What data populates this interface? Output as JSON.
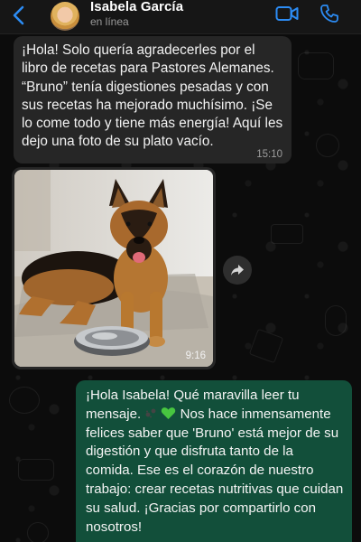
{
  "header": {
    "contact_name": "Isabela García",
    "status": "en línea",
    "icons": [
      "back-chevron-icon",
      "video-call-icon",
      "phone-call-icon"
    ],
    "accent_color": "#2c8cf4"
  },
  "messages": [
    {
      "direction": "incoming",
      "text": "¡Hola! Solo quería agradecerles por el libro de recetas para Pastores Alemanes. “Bruno” tenía digestiones pesadas y con sus recetas ha mejorado muchísimo. ¡Se lo come todo y tiene más energía! Aquí les dejo una foto de su plato vacío.",
      "time": "15:10"
    },
    {
      "direction": "incoming",
      "type": "image",
      "image_description": "german-shepherd-dog-lying-beside-empty-metal-bowl",
      "time": "9:16"
    },
    {
      "direction": "outgoing",
      "text_before_emoji": "¡Hola Isabela! Qué maravilla leer tu mensaje.",
      "emojis": [
        "paw-prints-icon",
        "green-heart-icon"
      ],
      "text_after_emoji": " Nos hace inmensamente felices saber que 'Bruno' está mejor de su digestión y que disfruta tanto de la comida. Ese es el corazón de nuestro trabajo: crear recetas nutritivas que cuidan su salud. ¡Gracias por compartirlo con nosotros!"
    }
  ],
  "colors": {
    "incoming_bubble": "#262626",
    "outgoing_bubble": "#124f3a",
    "background": "#0b0b0b"
  }
}
